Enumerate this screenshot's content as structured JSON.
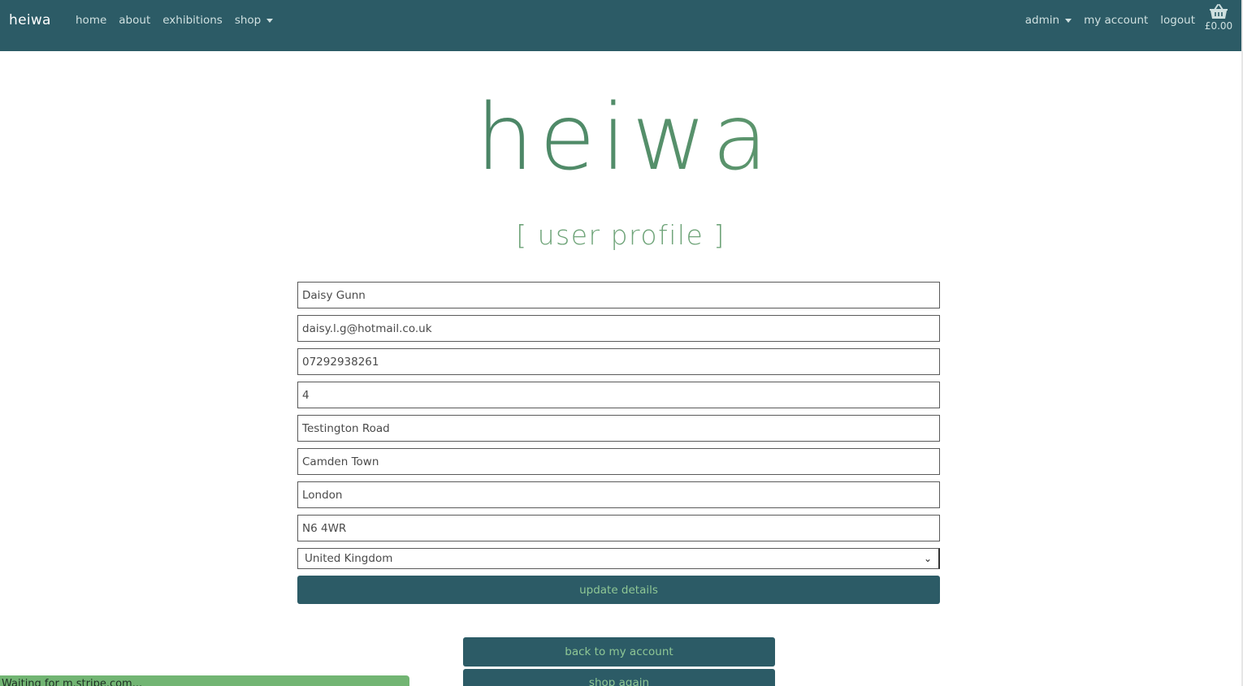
{
  "navbar": {
    "brand": "heiwa",
    "links": [
      "home",
      "about",
      "exhibitions",
      "shop"
    ],
    "admin": "admin",
    "my_account": "my account",
    "logout": "logout",
    "basket_total": "£0.00",
    "basket_icon": "basket-icon"
  },
  "hero": {
    "logo_text": "heiwa",
    "page_title": "[ user profile ]"
  },
  "profile_form": {
    "fields": [
      "Daisy Gunn",
      "daisy.l.g@hotmail.co.uk",
      "07292938261",
      "4",
      "Testington Road",
      "Camden Town",
      "London",
      "N6 4WR"
    ],
    "country": "United Kingdom",
    "update_label": "update details"
  },
  "actions": {
    "back_label": "back to my account",
    "shop_label": "shop again"
  },
  "status_text": "Waiting for m.stripe.com...",
  "colors": {
    "navbar": "#2c5b66",
    "accent_green": "#72b573",
    "button_text": "#8fc795"
  }
}
